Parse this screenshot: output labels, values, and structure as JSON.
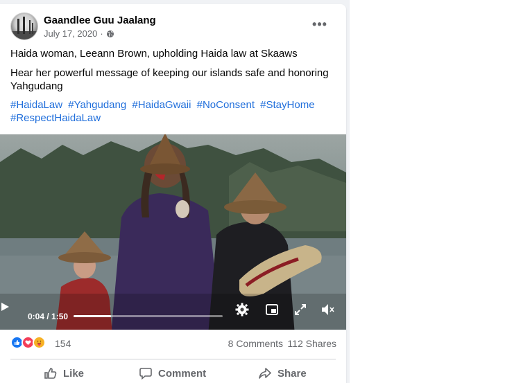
{
  "post": {
    "page_name": "Gaandlee Guu Jaalang",
    "date": "July 17, 2020",
    "date_separator": "·",
    "privacy_icon": "globe-icon",
    "more_label": "•••",
    "text_line1": "Haida woman, Leeann Brown, upholding Haida law at Skaaws",
    "text_line2": "Hear her powerful message of keeping our islands safe and honoring Yahgudang",
    "hashtags": [
      "#HaidaLaw",
      "#Yahgudang",
      "#HaidaGwaii",
      "#NoConsent",
      "#StayHome",
      "#RespectHaidaLaw"
    ]
  },
  "video": {
    "time": "0:04 / 1:50",
    "progress": 0.04,
    "icons": [
      "play-icon",
      "settings-gear-icon",
      "picture-in-picture-icon",
      "fullscreen-icon",
      "volume-muted-icon"
    ]
  },
  "stats": {
    "reactions": [
      "like-icon",
      "love-icon",
      "care-icon"
    ],
    "reaction_count": "154",
    "comments": "8 Comments",
    "shares": "112 Shares"
  },
  "actions": {
    "like": "Like",
    "comment": "Comment",
    "share": "Share"
  },
  "colors": {
    "hashtag": "#216fdb",
    "meta_text": "#65676b",
    "like_blue": "#1877f2",
    "love_red": "#f33e58",
    "care_yellow": "#f7b125"
  }
}
